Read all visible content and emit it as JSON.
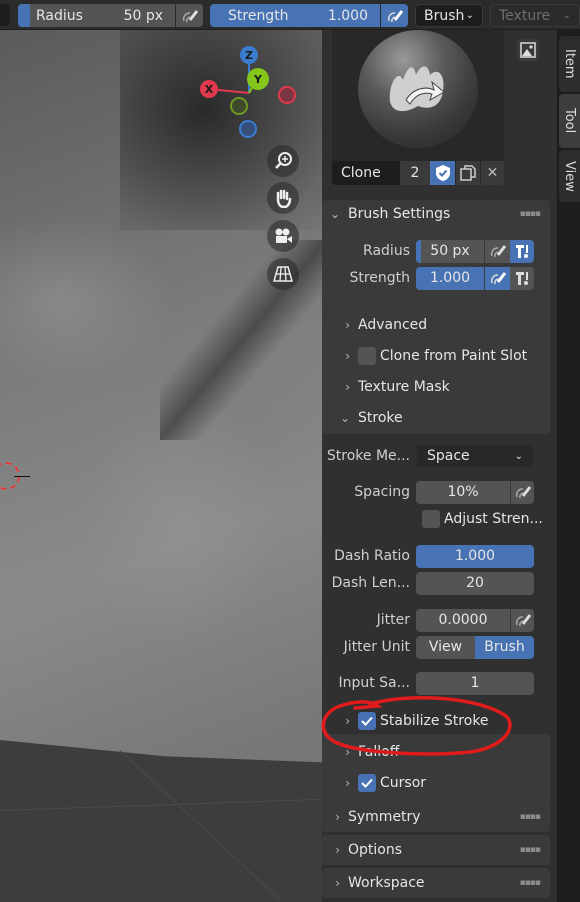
{
  "header": {
    "radius_label": "Radius",
    "radius_value": "50 px",
    "strength_label": "Strength",
    "strength_value": "1.000",
    "brush_dropdown": "Brush",
    "texture_dropdown": "Texture"
  },
  "gizmo": {
    "x_label": "X",
    "y_label": "Y",
    "z_label": "Z",
    "colors": {
      "x": "#e0394f",
      "y": "#84c61c",
      "z": "#3b7bd0"
    }
  },
  "nav_buttons": [
    "zoom-icon",
    "pan-hand-icon",
    "camera-icon",
    "perspective-grid-icon"
  ],
  "sidebar_tabs": [
    "Item",
    "Tool",
    "View"
  ],
  "brush_preview": {
    "name": "Clone",
    "users": "2"
  },
  "brush_settings": {
    "title": "Brush Settings",
    "radius_label": "Radius",
    "radius_value": "50 px",
    "strength_label": "Strength",
    "strength_value": "1.000",
    "subpanels": {
      "advanced": "Advanced",
      "clone_from_paint_slot": "Clone from Paint Slot",
      "clone_from_paint_slot_checked": false,
      "texture_mask": "Texture Mask",
      "stroke": "Stroke"
    }
  },
  "stroke": {
    "method_label": "Stroke Me...",
    "method_value": "Space",
    "spacing_label": "Spacing",
    "spacing_value": "10%",
    "adjust_strength_label": "Adjust Stren...",
    "adjust_strength_checked": false,
    "dash_ratio_label": "Dash Ratio",
    "dash_ratio_value": "1.000",
    "dash_length_label": "Dash Len...",
    "dash_length_value": "20",
    "jitter_label": "Jitter",
    "jitter_value": "0.0000",
    "jitter_unit_label": "Jitter Unit",
    "jitter_unit_options": [
      "View",
      "Brush"
    ],
    "jitter_unit_selected": "Brush",
    "input_samples_label": "Input Sa...",
    "input_samples_value": "1",
    "stabilize_stroke_label": "Stabilize Stroke",
    "stabilize_stroke_checked": true
  },
  "more_subpanels": {
    "falloff": "Falloff",
    "cursor": "Cursor",
    "cursor_checked": true
  },
  "sections": {
    "symmetry": "Symmetry",
    "options": "Options",
    "workspace": "Workspace"
  },
  "colors": {
    "accent": "#4772b3",
    "panel_bg": "#303030",
    "section_bg": "#3a3a3a",
    "field_bg": "#545454",
    "annotation": "#e01b1b"
  }
}
